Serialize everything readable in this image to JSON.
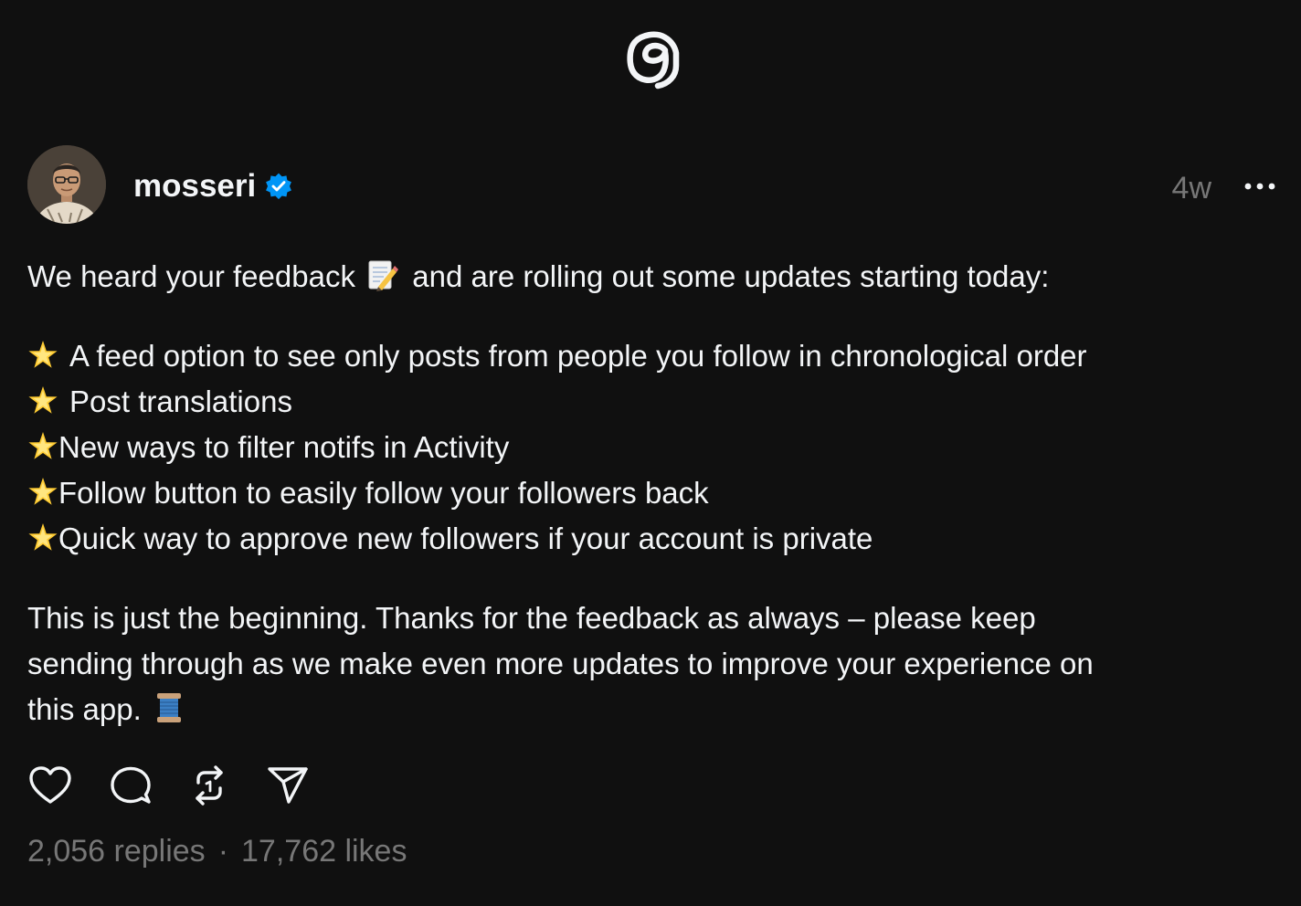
{
  "app": {
    "logo_icon": "threads-logo-icon"
  },
  "post": {
    "author": {
      "username": "mosseri",
      "verified": true,
      "verified_color": "#0095f6",
      "avatar_icon": "avatar-photo"
    },
    "timestamp": "4w",
    "more_icon": "more-options-icon",
    "intro": {
      "before_emoji": "We heard your feedback ",
      "emoji": "memo-emoji",
      "after_emoji": " and are rolling out some updates starting today:"
    },
    "bullet_emoji": "glowing-star-emoji",
    "updates": [
      {
        "text": "A feed option to see only posts from people you follow in chronological order"
      },
      {
        "text": "Post translations"
      },
      {
        "text": "New ways to filter notifs in Activity"
      },
      {
        "text": "Follow button to easily follow your followers back"
      },
      {
        "text": "Quick way to approve new followers if your account is private"
      }
    ],
    "closing": {
      "line1": "This is just the beginning. Thanks for the feedback as always – please keep",
      "line2": "sending through as we make even more updates to improve your experience on",
      "line3": "this app. ",
      "emoji": "thread-spool-emoji"
    },
    "actions": {
      "like_icon": "heart-icon",
      "reply_icon": "comment-icon",
      "repost_icon": "repost-icon",
      "share_icon": "share-icon"
    },
    "stats": {
      "replies": "2,056 replies",
      "separator": "·",
      "likes": "17,762 likes"
    }
  },
  "colors": {
    "background": "#101010",
    "text": "#f3f5f7",
    "secondary_text": "#777777",
    "verified": "#0095f6"
  }
}
